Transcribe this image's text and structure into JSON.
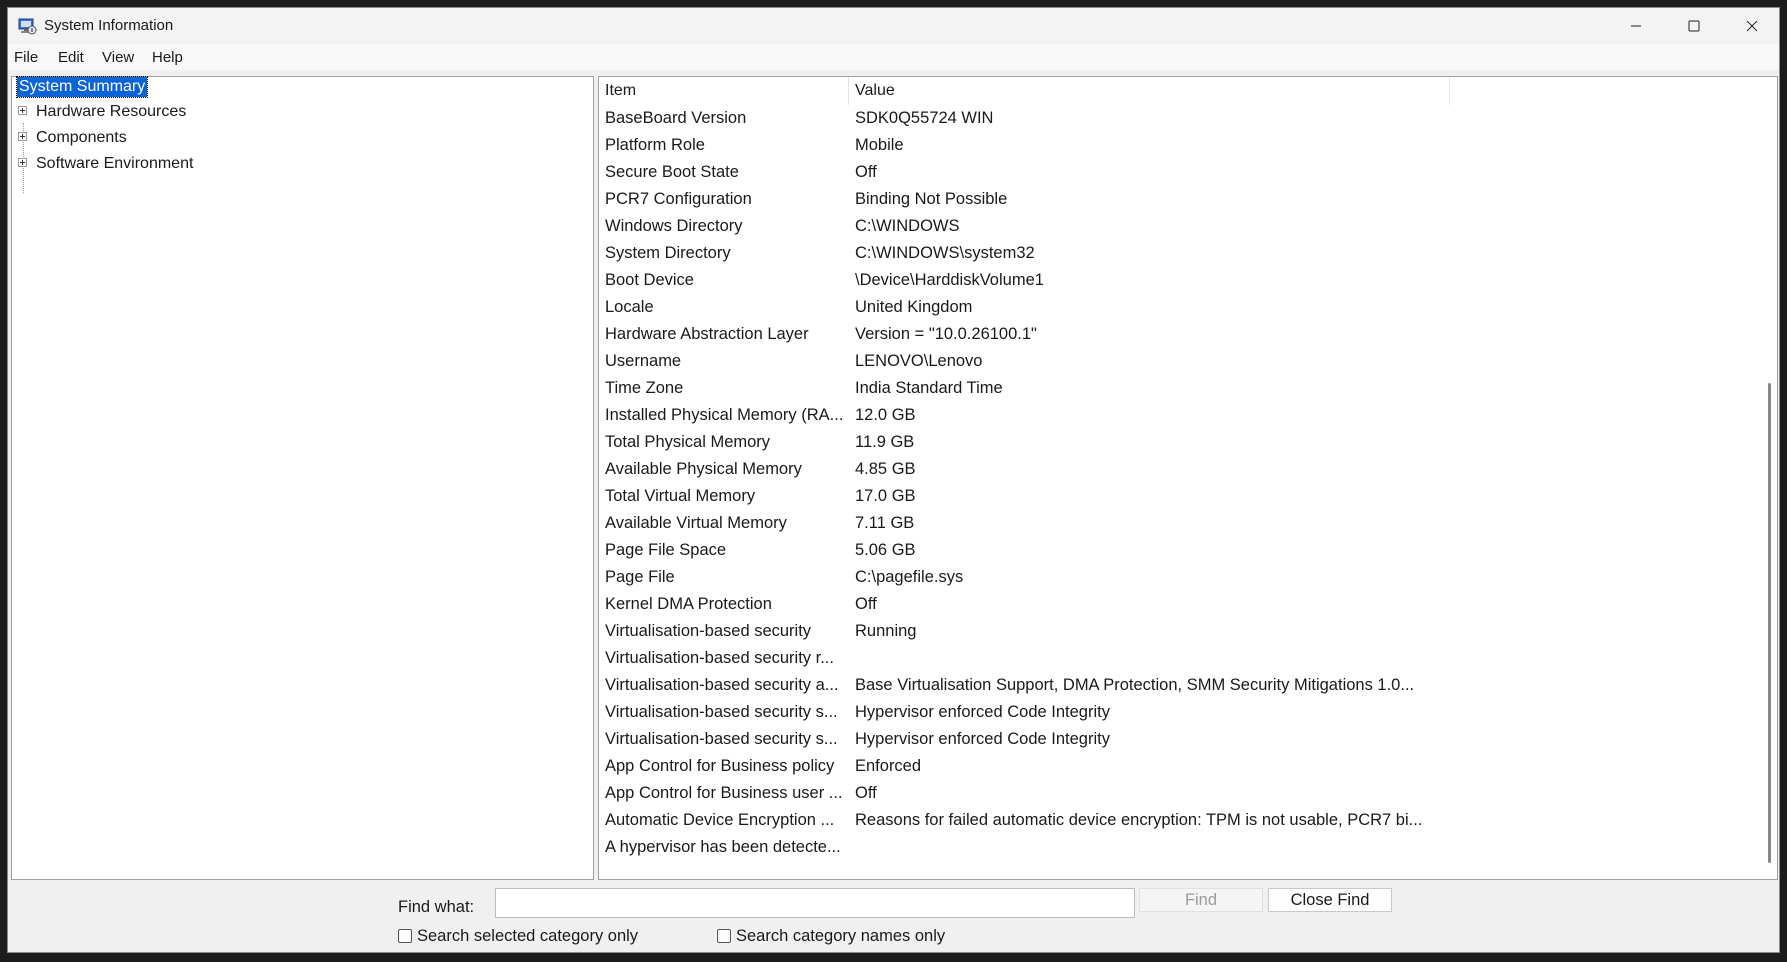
{
  "window": {
    "title": "System Information"
  },
  "menu": [
    "File",
    "Edit",
    "View",
    "Help"
  ],
  "tree": [
    {
      "label": "System Summary",
      "selected": true,
      "expandable": false
    },
    {
      "label": "Hardware Resources",
      "selected": false,
      "expandable": true
    },
    {
      "label": "Components",
      "selected": false,
      "expandable": true
    },
    {
      "label": "Software Environment",
      "selected": false,
      "expandable": true
    }
  ],
  "list": {
    "headers": {
      "item": "Item",
      "value": "Value"
    },
    "rows": [
      {
        "item": "BaseBoard Version",
        "value": "SDK0Q55724 WIN"
      },
      {
        "item": "Platform Role",
        "value": "Mobile"
      },
      {
        "item": "Secure Boot State",
        "value": "Off"
      },
      {
        "item": "PCR7 Configuration",
        "value": "Binding Not Possible"
      },
      {
        "item": "Windows Directory",
        "value": "C:\\WINDOWS"
      },
      {
        "item": "System Directory",
        "value": "C:\\WINDOWS\\system32"
      },
      {
        "item": "Boot Device",
        "value": "\\Device\\HarddiskVolume1"
      },
      {
        "item": "Locale",
        "value": "United Kingdom"
      },
      {
        "item": "Hardware Abstraction Layer",
        "value": "Version = \"10.0.26100.1\""
      },
      {
        "item": "Username",
        "value": "LENOVO\\Lenovo"
      },
      {
        "item": "Time Zone",
        "value": "India Standard Time"
      },
      {
        "item": "Installed Physical Memory (RA...",
        "value": "12.0 GB"
      },
      {
        "item": "Total Physical Memory",
        "value": "11.9 GB"
      },
      {
        "item": "Available Physical Memory",
        "value": "4.85 GB"
      },
      {
        "item": "Total Virtual Memory",
        "value": "17.0 GB"
      },
      {
        "item": "Available Virtual Memory",
        "value": "7.11 GB"
      },
      {
        "item": "Page File Space",
        "value": "5.06 GB"
      },
      {
        "item": "Page File",
        "value": "C:\\pagefile.sys"
      },
      {
        "item": "Kernel DMA Protection",
        "value": "Off"
      },
      {
        "item": "Virtualisation-based security",
        "value": "Running"
      },
      {
        "item": "Virtualisation-based security r...",
        "value": ""
      },
      {
        "item": "Virtualisation-based security a...",
        "value": "Base Virtualisation Support, DMA Protection, SMM Security Mitigations 1.0..."
      },
      {
        "item": "Virtualisation-based security s...",
        "value": "Hypervisor enforced Code Integrity"
      },
      {
        "item": "Virtualisation-based security s...",
        "value": "Hypervisor enforced Code Integrity"
      },
      {
        "item": "App Control for Business policy",
        "value": "Enforced"
      },
      {
        "item": "App Control for Business user ...",
        "value": "Off"
      },
      {
        "item": "Automatic Device Encryption ...",
        "value": "Reasons for failed automatic device encryption: TPM is not usable, PCR7 bi..."
      },
      {
        "item": "A hypervisor has been detecte...",
        "value": ""
      }
    ]
  },
  "find": {
    "label": "Find what:",
    "value": "",
    "find_button": "Find",
    "close_button": "Close Find",
    "search_selected_label": "Search selected category only",
    "search_names_label": "Search category names only"
  }
}
